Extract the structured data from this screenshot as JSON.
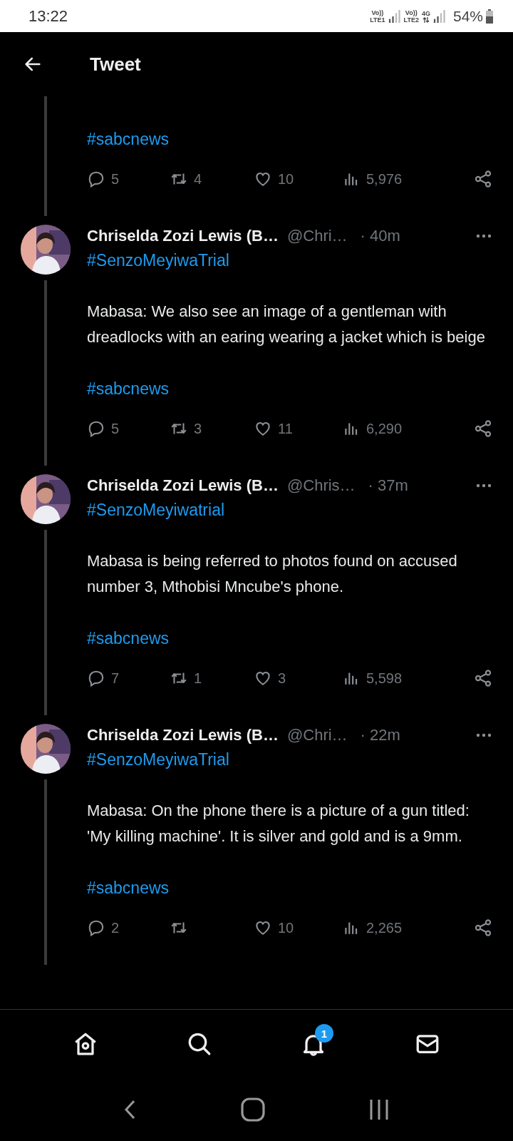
{
  "status_bar": {
    "time": "13:22",
    "sim1": {
      "volte": "Vo))",
      "band": "LTE1"
    },
    "sim2": {
      "volte": "Vo))",
      "band": "LTE2",
      "data": "4G"
    },
    "battery": "54%"
  },
  "header": {
    "title": "Tweet"
  },
  "previous_tweet": {
    "footer_hashtag": "#sabcnews",
    "stats": {
      "replies": "5",
      "retweets": "4",
      "likes": "10",
      "views": "5,976"
    }
  },
  "tweets": [
    {
      "name": "Chriselda Zozi Lewis (B…",
      "handle": "@Chri…",
      "time": "· 40m",
      "hashtag": "#SenzoMeyiwaTrial",
      "body": "Mabasa: We also see an image of a gentleman with dreadlocks with an earing wearing a jacket which is beige",
      "footer_hashtag": "#sabcnews",
      "stats": {
        "replies": "5",
        "retweets": "3",
        "likes": "11",
        "views": "6,290"
      }
    },
    {
      "name": "Chriselda Zozi Lewis (B…",
      "handle": "@Chris…",
      "time": "· 37m",
      "hashtag": "#SenzoMeyiwatrial",
      "body": "Mabasa is being referred to photos found on accused number 3, Mthobisi Mncube's phone.",
      "footer_hashtag": "#sabcnews",
      "stats": {
        "replies": "7",
        "retweets": "1",
        "likes": "3",
        "views": "5,598"
      }
    },
    {
      "name": "Chriselda Zozi Lewis (B…",
      "handle": "@Chri…",
      "time": "· 22m",
      "hashtag": "#SenzoMeyiwaTrial",
      "body": "Mabasa: On the phone there is a picture of a gun titled: 'My killing machine'. It is silver and gold and is a 9mm.",
      "footer_hashtag": "#sabcnews",
      "stats": {
        "replies": "2",
        "likes": "10",
        "views": "2,265"
      }
    }
  ],
  "bottom_nav": [
    {
      "kind": "home"
    },
    {
      "kind": "search"
    },
    {
      "kind": "notifications",
      "badge": "1"
    },
    {
      "kind": "messages"
    }
  ]
}
